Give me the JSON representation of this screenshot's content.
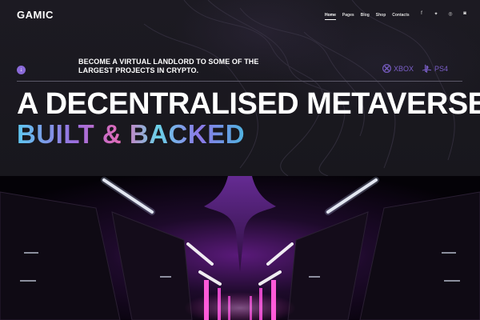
{
  "header": {
    "logo": "GAMIC",
    "nav": [
      {
        "label": "Home",
        "active": true
      },
      {
        "label": "Pages",
        "active": false
      },
      {
        "label": "Blog",
        "active": false
      },
      {
        "label": "Shop",
        "active": false
      },
      {
        "label": "Contacts",
        "active": false
      }
    ],
    "social_icons": [
      "facebook-icon",
      "twitter-icon",
      "dribbble-icon",
      "instagram-icon"
    ]
  },
  "hero": {
    "tagline": "BECOME A VIRTUAL LANDLORD TO SOME OF THE LARGEST PROJECTS IN CRYPTO.",
    "platforms": [
      {
        "label": "XBOX",
        "icon": "xbox-icon"
      },
      {
        "label": "PS4",
        "icon": "playstation-icon"
      }
    ],
    "headline_line1": "A DECENTRALISED METAVERSE",
    "headline_line2": "BUILT & BACKED",
    "scroll_icon": "arrow-down-icon"
  },
  "colors": {
    "accent": "#8a6ad8",
    "platform": "#7b5fc9",
    "background": "#18171d"
  }
}
